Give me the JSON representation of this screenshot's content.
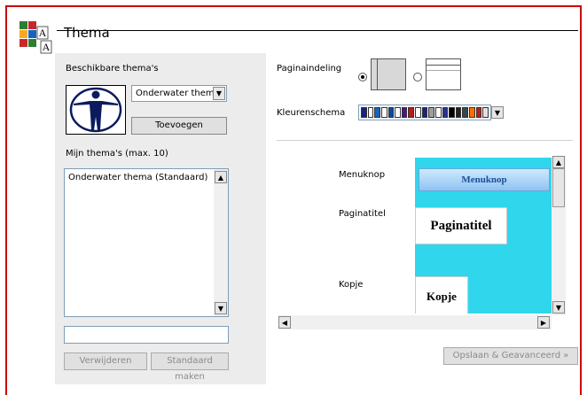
{
  "header": {
    "title": "Thema"
  },
  "left": {
    "available_label": "Beschikbare thema's",
    "theme_select_value": "Onderwater thema",
    "add_button": "Toevoegen",
    "my_themes_label": "Mijn thema's (max. 10)",
    "my_themes": [
      "Onderwater thema (Standaard)"
    ],
    "name_input_value": "",
    "remove_button": "Verwijderen",
    "default_button": "Standaard maken"
  },
  "right": {
    "layout_label": "Paginaindeling",
    "layout_selected": "left",
    "color_scheme_label": "Kleurenschema",
    "color_swatches": [
      "#1a237e",
      "#ffffff",
      "#1565c0",
      "#ffffff",
      "#0d47a1",
      "#ffffff",
      "#4a148c",
      "#b71c1c",
      "#ffffff",
      "#1a237e",
      "#9e9e9e",
      "#ffffff",
      "#283593",
      "#000000",
      "#212121",
      "#37474f",
      "#ff6f00",
      "#b71c1c",
      "#e0e0e0"
    ],
    "preview_labels": [
      "Menuknop",
      "Paginatitel",
      "Kopje"
    ],
    "preview": {
      "menu_button": "Menuknop",
      "page_title": "Paginatitel",
      "heading": "Kopje",
      "background": "#2fd6ec"
    },
    "save_button": "Opslaan & Geavanceerd »"
  }
}
